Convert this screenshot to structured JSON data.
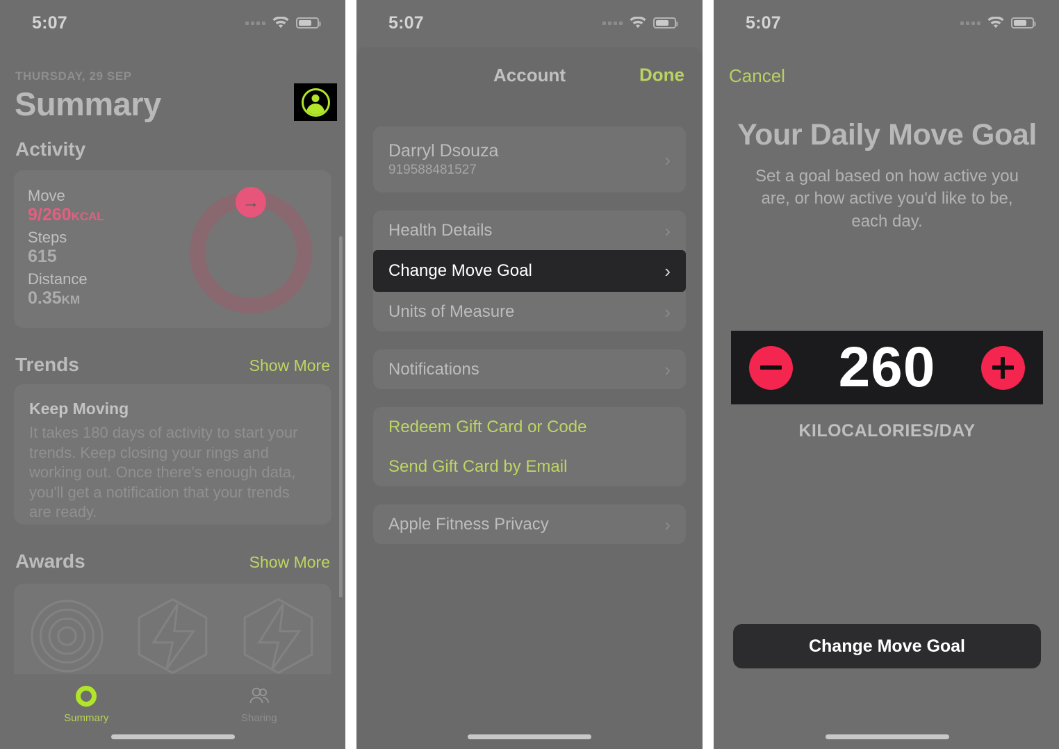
{
  "theme": {
    "dim_background": "#6e6e6e",
    "accent_green": "#b0e52a",
    "link_green": "#bcd664",
    "move_pink": "#F4254F",
    "highlight_black": "#262628"
  },
  "status_bar": {
    "time": "5:07",
    "signal_icon": "signal-dots-icon",
    "wifi_icon": "wifi-icon",
    "battery_icon": "battery-icon"
  },
  "panel1": {
    "date": "THURSDAY, 29 SEP",
    "title": "Summary",
    "avatar_icon": "account-avatar-icon",
    "sections": {
      "activity": {
        "heading": "Activity"
      },
      "trends": {
        "heading": "Trends",
        "link": "Show More"
      },
      "awards": {
        "heading": "Awards",
        "link": "Show More"
      }
    },
    "activity_card": {
      "move_label": "Move",
      "move_value": "9/260",
      "move_unit": "KCAL",
      "steps_label": "Steps",
      "steps_value": "615",
      "distance_label": "Distance",
      "distance_value": "0.35",
      "distance_unit": "KM",
      "ring_badge_icon": "arrow-right-icon"
    },
    "trends_card": {
      "title": "Keep Moving",
      "body": "It takes 180 days of activity to start your trends. Keep closing your rings and working out. Once there's enough data, you'll get a notification that your trends are ready."
    },
    "awards_card": {
      "badges": [
        "rings-target-badge",
        "lightning-hexagon-badge",
        "lightning-hexagon-badge"
      ]
    },
    "tabs": [
      {
        "label": "Summary",
        "icon": "activity-ring-icon",
        "active": true
      },
      {
        "label": "Sharing",
        "icon": "people-sharing-icon",
        "active": false
      }
    ]
  },
  "panel2": {
    "nav_title": "Account",
    "done_label": "Done",
    "user": {
      "name": "Darryl Dsouza",
      "phone": "919588481527",
      "chevron": "›"
    },
    "groups": [
      {
        "rows": [
          {
            "label": "Health Details",
            "chevron": "›",
            "kind": "nav"
          },
          {
            "label": "Change Move Goal",
            "chevron": "›",
            "kind": "highlight"
          },
          {
            "label": "Units of Measure",
            "chevron": "›",
            "kind": "nav"
          }
        ]
      },
      {
        "rows": [
          {
            "label": "Notifications",
            "chevron": "›",
            "kind": "nav"
          }
        ]
      },
      {
        "rows": [
          {
            "label": "Redeem Gift Card or Code",
            "chevron": "",
            "kind": "link"
          },
          {
            "label": "Send Gift Card by Email",
            "chevron": "",
            "kind": "link"
          }
        ]
      },
      {
        "rows": [
          {
            "label": "Apple Fitness Privacy",
            "chevron": "›",
            "kind": "nav"
          }
        ]
      }
    ]
  },
  "panel3": {
    "cancel_label": "Cancel",
    "title": "Your Daily Move Goal",
    "subtitle": "Set a goal based on how active you are, or how active you'd like to be, each day.",
    "stepper": {
      "decrement_icon": "minus-circle-icon",
      "increment_icon": "plus-circle-icon",
      "value": "260"
    },
    "unit_label": "KILOCALORIES/DAY",
    "cta_label": "Change Move Goal"
  }
}
